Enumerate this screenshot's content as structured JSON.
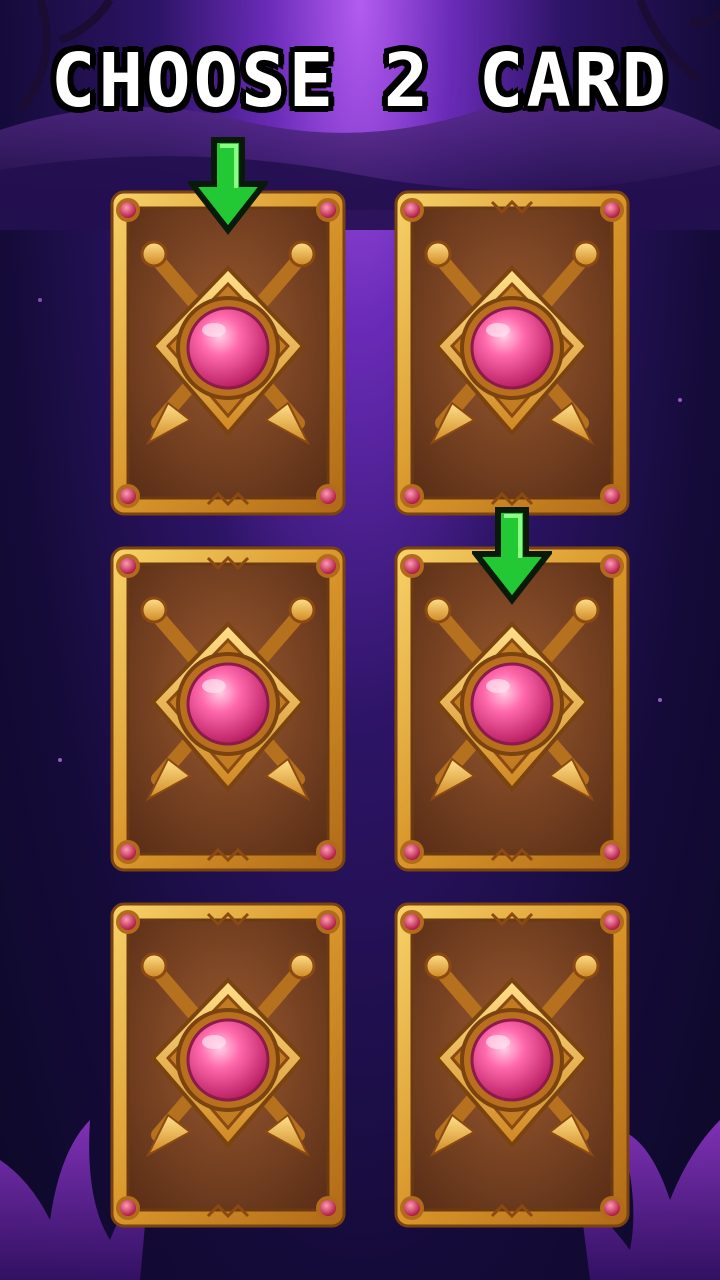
{
  "title": "CHOOSE 2 CARD",
  "colors": {
    "title_text": "#ffffff",
    "title_outline": "#000000",
    "card_frame": "#e2a531",
    "card_face": "#8a4a26",
    "gem": "#ff5ca0",
    "arrow": "#29d83c"
  },
  "cards": [
    {
      "row": 1,
      "col": 1,
      "highlighted": true
    },
    {
      "row": 1,
      "col": 2,
      "highlighted": false
    },
    {
      "row": 2,
      "col": 1,
      "highlighted": false
    },
    {
      "row": 2,
      "col": 2,
      "highlighted": true
    },
    {
      "row": 3,
      "col": 1,
      "highlighted": false
    },
    {
      "row": 3,
      "col": 2,
      "highlighted": false
    }
  ],
  "icons": {
    "card_emblem": "crossed-swords-shield-gem-icon",
    "pointer": "down-arrow-icon"
  }
}
